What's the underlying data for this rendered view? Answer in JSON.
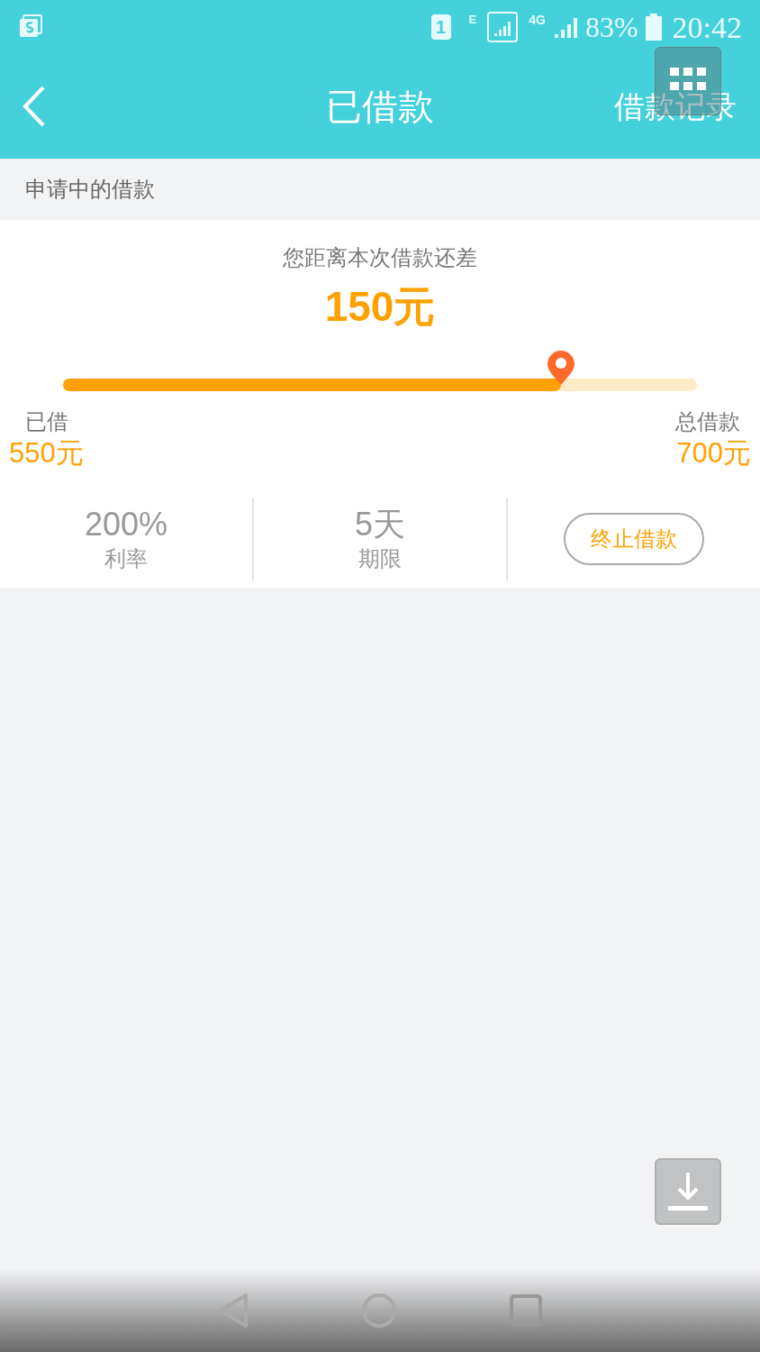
{
  "status_bar": {
    "sim": "1",
    "network": "E",
    "data": "4G",
    "battery": "83%",
    "time": "20:42"
  },
  "header": {
    "title": "已借款",
    "action": "借款记录"
  },
  "section": {
    "title": "申请中的借款"
  },
  "progress": {
    "caption": "您距离本次借款还差",
    "remaining": "150元",
    "level": 0.786,
    "borrowed_label": "已借",
    "borrowed": "550元",
    "total_label": "总借款",
    "total": "700元"
  },
  "stats": [
    {
      "value": "200%",
      "label": "利率"
    },
    {
      "value": "5天",
      "label": "期限"
    }
  ],
  "terminate_button": "终止借款"
}
